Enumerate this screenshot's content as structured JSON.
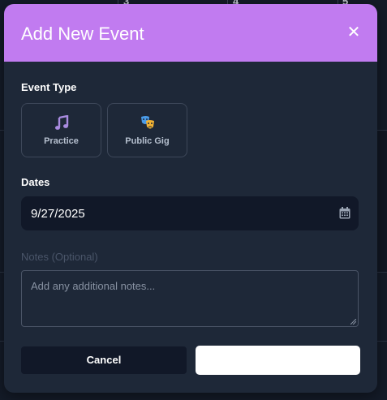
{
  "background": {
    "day_numbers": [
      "3",
      "4",
      "5"
    ]
  },
  "modal": {
    "title": "Add New Event",
    "close_symbol": "✕",
    "event_type_label": "Event Type",
    "event_types": [
      {
        "label": "Practice",
        "icon": "music-note-icon"
      },
      {
        "label": "Public Gig",
        "icon": "theater-masks-icon"
      }
    ],
    "dates_label": "Dates",
    "date_value": "9/27/2025",
    "notes_label": "Notes (Optional)",
    "notes_placeholder": "Add any additional notes...",
    "cancel_label": "Cancel",
    "submit_label": ""
  },
  "colors": {
    "header": "#c17bf0",
    "modal_bg": "#1e2838",
    "field_bg": "#111828",
    "page_bg": "#141b28"
  }
}
